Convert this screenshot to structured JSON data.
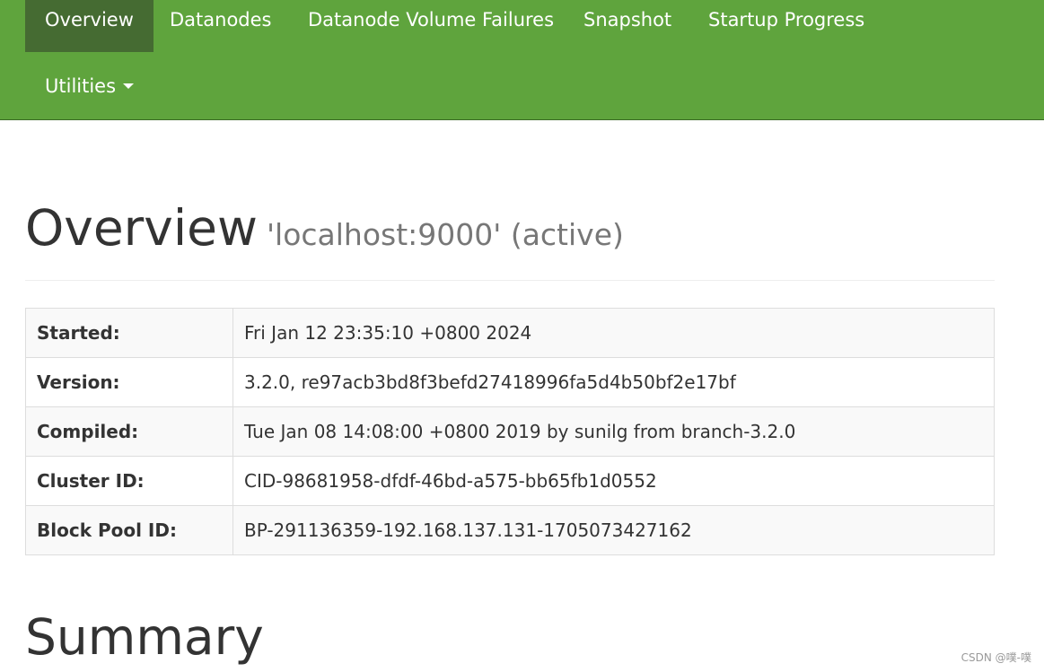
{
  "nav": {
    "items": [
      {
        "label": "Overview"
      },
      {
        "label": "Datanodes"
      },
      {
        "label": "Datanode Volume Failures"
      },
      {
        "label": "Snapshot"
      },
      {
        "label": "Startup Progress"
      },
      {
        "label": "Utilities"
      }
    ],
    "active": "Overview"
  },
  "header": {
    "title": "Overview",
    "subtitle": "'localhost:9000' (active)"
  },
  "info": {
    "rows": [
      {
        "key": "Started:",
        "value": "Fri Jan 12 23:35:10 +0800 2024"
      },
      {
        "key": "Version:",
        "value": "3.2.0, re97acb3bd8f3befd27418996fa5d4b50bf2e17bf"
      },
      {
        "key": "Compiled:",
        "value": "Tue Jan 08 14:08:00 +0800 2019 by sunilg from branch-3.2.0"
      },
      {
        "key": "Cluster ID:",
        "value": "CID-98681958-dfdf-46bd-a575-bb65fb1d0552"
      },
      {
        "key": "Block Pool ID:",
        "value": "BP-291136359-192.168.137.131-1705073427162"
      }
    ]
  },
  "summary": {
    "title": "Summary"
  },
  "watermark": "CSDN @噗-噗",
  "colors": {
    "navbar": "#5fa43d",
    "nav_active": "#456b32"
  }
}
